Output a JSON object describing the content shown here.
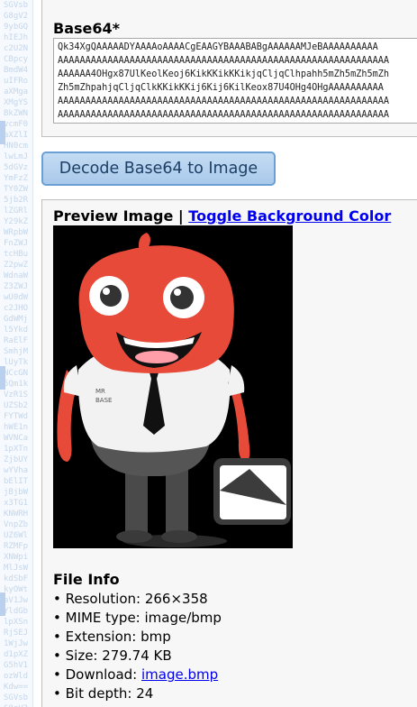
{
  "base64_section": {
    "label": "Base64*",
    "lines": [
      "Qk34XgQAAAAADYAAAAoAAAACgEAAGYBAAABABgAAAAAAMJeBAAAAAAAAAA",
      "AAAAAAAAAAAAAAAAAAAAAAAAAAAAAAAAAAAAAAAAAAAAAAAAAAAAAAAAAAAA",
      "AAAAAA4OHgx87UlKeolKeoj6KikKKikKKikjqCljqClhpahh5mZh5mZh5mZh",
      "Zh5mZhpahjqCljqClkKKikKKij6Kij6KilKeox87U4OHg4OHgAAAAAAAAAA",
      "AAAAAAAAAAAAAAAAAAAAAAAAAAAAAAAAAAAAAAAAAAAAAAAAAAAAAAAAAAAA",
      "AAAAAAAAAAAAAAAAAAAAAAAAAAAAAAAAAAAAAAAAAAAAAAAAAAAAAAAAAAAA"
    ]
  },
  "decode_button": {
    "label": "Decode Base64 to Image"
  },
  "preview": {
    "title": "Preview Image",
    "separator": " | ",
    "toggle_link": "Toggle Background Color"
  },
  "image": {
    "shirt_text_line1": "MR",
    "shirt_text_line2": "BASE"
  },
  "file_info": {
    "title": "File Info",
    "items": [
      {
        "key": "Resolution: ",
        "value": "266×358"
      },
      {
        "key": "MIME type: ",
        "value": "image/bmp"
      },
      {
        "key": "Extension: ",
        "value": "bmp"
      },
      {
        "key": "Size: ",
        "value": "279.74 KB"
      },
      {
        "key": "Download: ",
        "value": "image.bmp"
      },
      {
        "key": "Bit depth: ",
        "value": "24"
      }
    ]
  },
  "left_strip": {
    "pattern": "SGVsbG8gV29ybGQhIEJhc2U2NCBpcyBmdW4uIFRoaXMgaXMgYSBkZWNvcmF0aXZlIHN0cmlwLmJ5dGVzYmFzZTY0ZW5jb2RlZGRlY29kZWRpbWFnZWJtcHBuZ2pwZWdnaWZ3ZWJwU0dWc2JHOGdWMjl5YkdRaElFSmhjMlUyTkNCcGN5Qm1kVzR1SUZSb2FYTWdhWE1nWVNCa1pXTnZjbUYwYVhabElITjBjbWx3TG1KNWRHVnpZbUZ6WlRZMFpXNWpiMlJsWkdSbFkyOWtaV1JwYldGblpXSnRjSEJ1WjJwd1pXZG5hV1ozWldKdw==SGVsbG8gV29ybGQhIEJhc2U2NCBpcyBmdW4uIFRoaXMgaXMgYSBkZWNvcmF0aXZlIHN0cmlwLmJ5dGVzYmFzZTY0ZW5jb2RlZGRlY29kZWRpbWFnZWJtcHBuZ2pwZWdnaWZ3ZWJwU0dWc2JHOGdWMjl5YkdRaElFSmhjMlUyTkNCcGN5Qm1kVzR1SUZSb2FYTWdhWE1nWVNCa1pXTnZjbUYwYVhabElITjBjbWx3TG1KNWRHVnpZbUZ6WlRZMFpXNWpiMlJsWkdSbFkyOWtaV1JwYldGblpXSnRjSEJ1WjJwd1pXZG5hV1ozWldKdw=="
  }
}
